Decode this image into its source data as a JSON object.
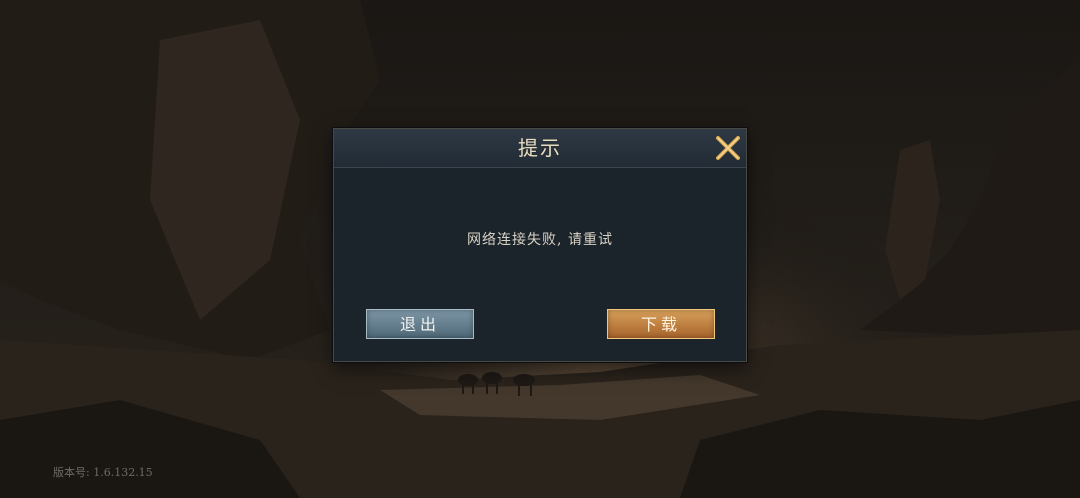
{
  "dialog": {
    "title": "提示",
    "message": "网络连接失败, 请重试",
    "close_icon": "close-x-icon",
    "buttons": {
      "exit_label": "退出",
      "download_label": "下载"
    }
  },
  "footer": {
    "version": "版本号: 1.6.132.15"
  },
  "colors": {
    "exit_button": "#6a8493",
    "download_button": "#c0803f",
    "title_text": "#e9dcc0",
    "close_icon": "#d9a94e"
  }
}
